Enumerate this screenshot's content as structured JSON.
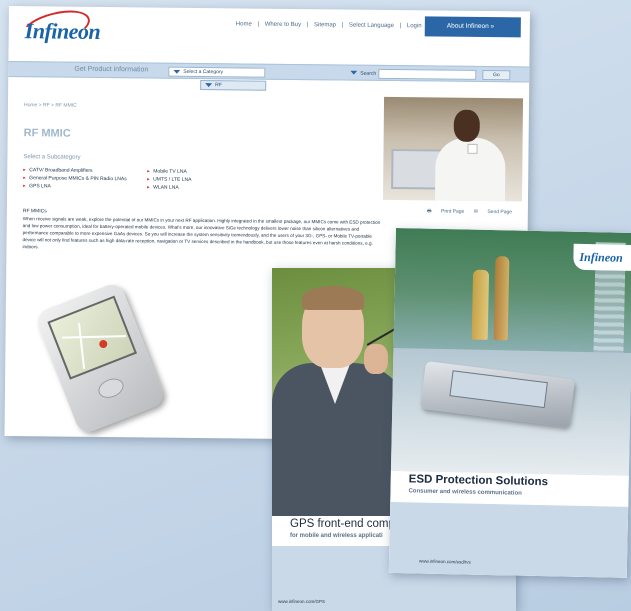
{
  "web": {
    "logo": "Infineon",
    "topnav": [
      "Home",
      "|",
      "Where to Buy",
      "|",
      "Sitemap",
      "|",
      "Select Language",
      "|",
      "Login"
    ],
    "about_button": "About Infineon »",
    "bar_title": "Get Product information",
    "category_select": "Select a Category",
    "rf_tab": "RF",
    "search_label": "Search",
    "go_button": "Go",
    "breadcrumb": "Home > RF > RF MMIC",
    "page_title": "RF MMIC",
    "subcategory_heading": "Select a Subcategory",
    "subcategories": [
      "CATV/ Broadband Amplifiers",
      "General Purpose MMICs & PIN Radio LNAs",
      "GPS LNA",
      "Mobile TV LNA",
      "UMTS / LTE LNA",
      "WLAN LNA"
    ],
    "description_heading": "RF MMICs",
    "description": "When receive signals are weak, explore the potential of our MMICs in your next RF application. Highly integrated in the smallest package, our MMICs come with ESD protection and low power consumption, ideal for battery-operated mobile devices. What's more, our innovative SiGe technology delivers lower noise than silicon alternatives and performance comparable to more expensive GaAs devices. So you will increase the system sensitivity tremendously, and the users of your 3G-, GPS- or Mobile TV-portable device will not only find features such as high data-rate reception, navigation or TV services described in the handbook, but use those features even at harsh conditions, e.g. indoors.",
    "print_page": "Print Page",
    "send_page": "Send Page"
  },
  "gps": {
    "title": "GPS front-end compo",
    "subtitle": "for mobile and wireless applicati",
    "url": "www.infineon.com/GPS"
  },
  "esd": {
    "logo": "Infineon",
    "title": "ESD Protection Solutions",
    "subtitle": "Consumer and wireless communication",
    "url": "www.infineon.com/esd/tvs"
  }
}
